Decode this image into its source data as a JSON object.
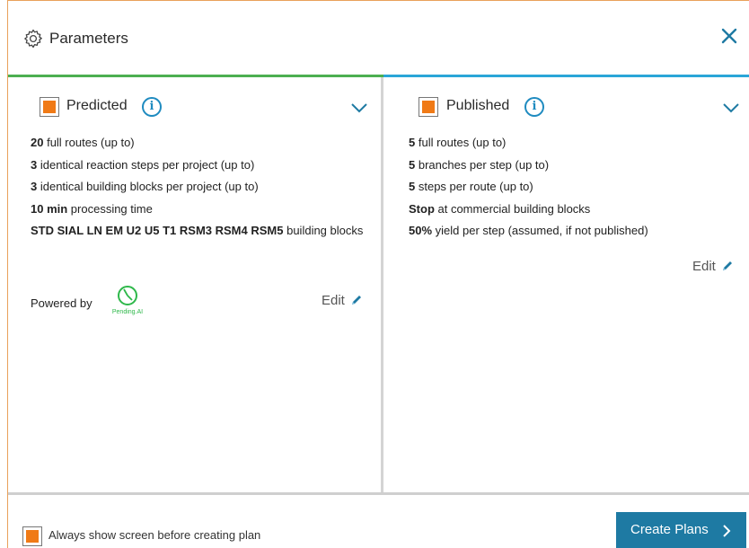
{
  "dialog": {
    "title": "Parameters",
    "accent_orange": "#f07a16",
    "accent_blue": "#1e7aa3"
  },
  "predicted": {
    "label": "Predicted",
    "checked": true,
    "lines": [
      {
        "bold": "20",
        "text": " full routes (up to)"
      },
      {
        "bold": "3",
        "text": " identical reaction steps per project (up to)"
      },
      {
        "bold": "3",
        "text": " identical building blocks per project (up to)"
      },
      {
        "bold": "10 min",
        "text": " processing time"
      },
      {
        "bold": "STD SIAL LN EM U2 U5 T1 RSM3 RSM4 RSM5",
        "text": " building blocks"
      }
    ],
    "powered_by": "Powered by",
    "logo_text": "Pending.AI",
    "edit_label": "Edit"
  },
  "published": {
    "label": "Published",
    "checked": true,
    "lines": [
      {
        "bold": "5",
        "text": " full routes (up to)"
      },
      {
        "bold": "5",
        "text": " branches per step (up to)"
      },
      {
        "bold": "5",
        "text": " steps per route (up to)"
      },
      {
        "bold": "Stop",
        "text": " at commercial building blocks"
      },
      {
        "bold": "50%",
        "text": " yield per step (assumed, if not published)"
      }
    ],
    "edit_label": "Edit"
  },
  "footer": {
    "always_show_label": "Always show screen before creating plan",
    "always_show_checked": true,
    "create_button": "Create Plans"
  }
}
